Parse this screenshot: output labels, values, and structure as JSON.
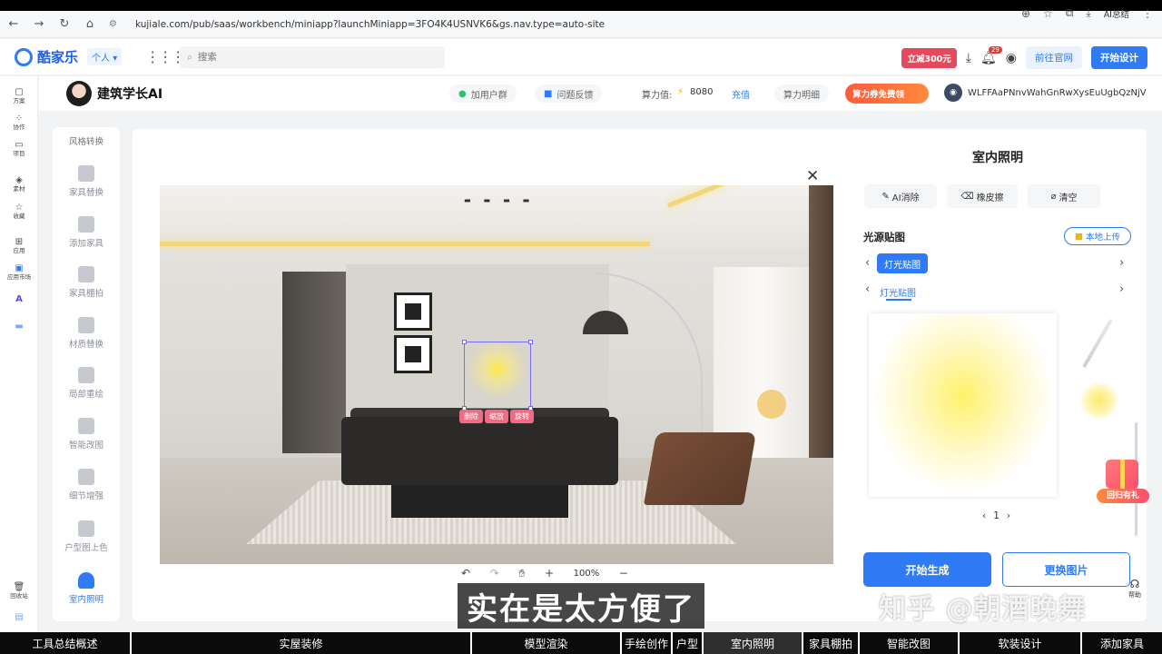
{
  "browser": {
    "url": "kujiale.com/pub/saas/workbench/miniapp?launchMiniapp=3FO4K4USNVK6&gs.nav.type=auto-site",
    "profile_label": "AI总结"
  },
  "header": {
    "logo_text": "酷家乐",
    "persona": "个人",
    "search_placeholder": "搜索",
    "promo": "立减300元",
    "notification_count": "29",
    "official_site": "前往官网",
    "start_design": "开始设计"
  },
  "left_rail": [
    {
      "label": "方案",
      "icon": "plan-icon"
    },
    {
      "label": "协作",
      "icon": "collab-icon"
    },
    {
      "label": "项目",
      "icon": "folder-icon"
    },
    {
      "label": "素材",
      "icon": "cube-icon"
    },
    {
      "label": "收藏",
      "icon": "star-icon"
    },
    {
      "label": "应用",
      "icon": "apps-icon"
    },
    {
      "label": "应用市场",
      "icon": "market-icon"
    },
    {
      "label": "回收站",
      "icon": "trash-icon"
    }
  ],
  "subheader": {
    "brand": "建筑学长AI",
    "join_group": "加用户群",
    "feedback": "问题反馈",
    "compute_label": "算力值:",
    "compute_value": "8080",
    "recharge": "充值",
    "compute_detail": "算力明细",
    "coupon": "算力券免费领",
    "username": "WLFFAaPNnvWahGnRwXysEuUgbQzNjV"
  },
  "tools": {
    "section_title": "风格转换",
    "items": [
      "家具替换",
      "添加家具",
      "家具棚拍",
      "材质替换",
      "局部重绘",
      "智能改图",
      "细节增强",
      "户型图上色",
      "室内照明"
    ]
  },
  "canvas": {
    "selection_tools": [
      "删除",
      "缩放",
      "旋转"
    ],
    "zoom": "100%"
  },
  "right_panel": {
    "title": "室内照明",
    "tools": [
      "AI消除",
      "橡皮擦",
      "清空"
    ],
    "section": "光源贴图",
    "upload": "本地上传",
    "tag_active": "灯光贴图",
    "tag_link": "灯光贴图",
    "page": "1",
    "gift_label": "回归有礼",
    "generate": "开始生成",
    "replace": "更换图片",
    "help": "帮助"
  },
  "overlay": {
    "subtitle": "实在是太方便了",
    "watermark": "知乎 @朝酒晚舞"
  },
  "chapters": [
    {
      "label": "工具总结概述",
      "w": 145
    },
    {
      "label": "实屋装修",
      "w": 375
    },
    {
      "label": "模型渲染",
      "w": 165
    },
    {
      "label": "手绘创作",
      "w": 56
    },
    {
      "label": "户型",
      "w": 34
    },
    {
      "label": "室内照明",
      "w": 110
    },
    {
      "label": "家具棚拍",
      "w": 62
    },
    {
      "label": "智能改图",
      "w": 110
    },
    {
      "label": "软装设计",
      "w": 135
    },
    {
      "label": "添加家具",
      "w": 88
    }
  ],
  "active_chapter": "室内照明"
}
